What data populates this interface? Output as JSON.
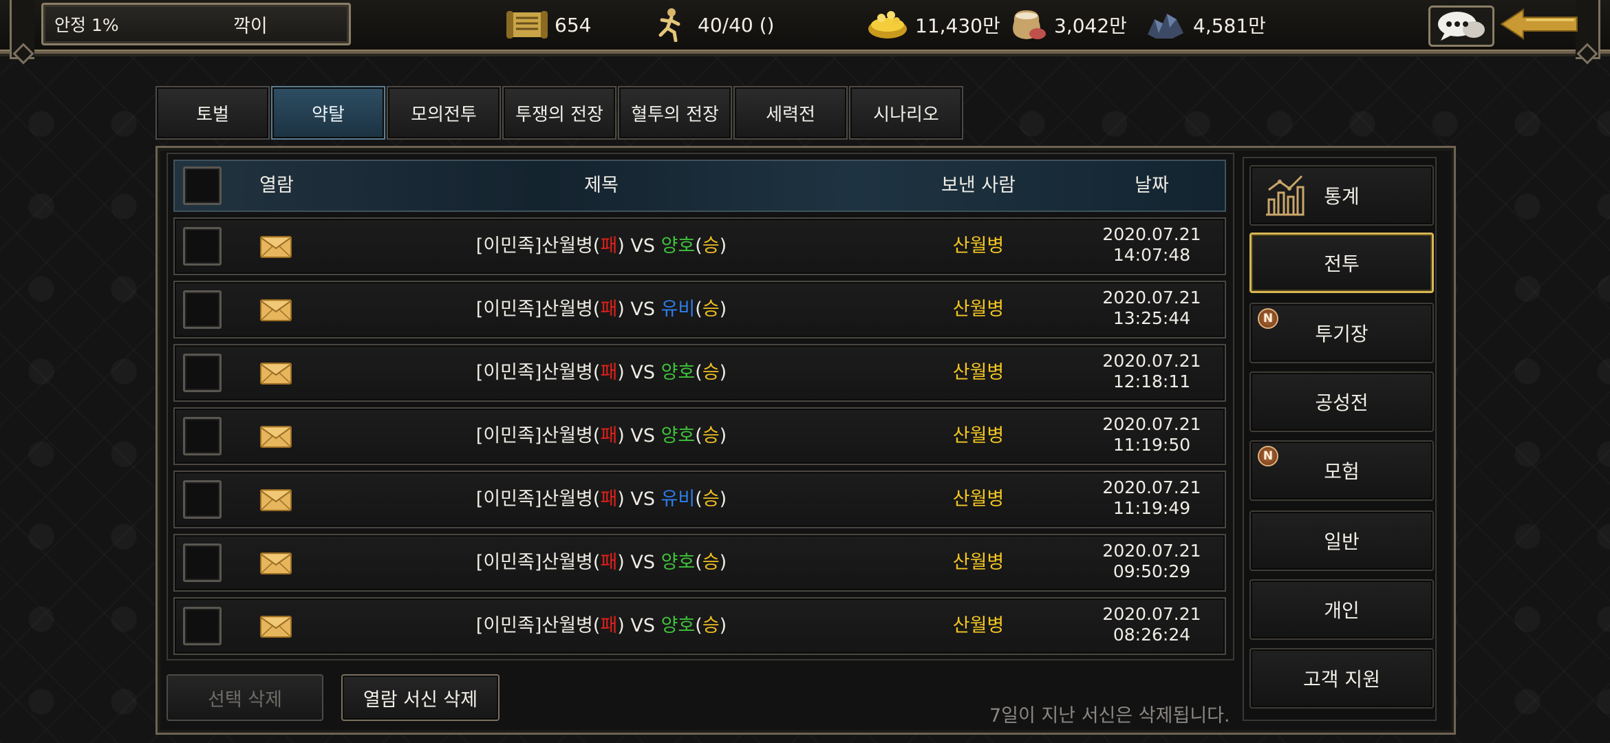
{
  "topbar": {
    "stability": "안정 1%",
    "character_name": "깍이",
    "resources": [
      {
        "icon": "scroll-icon",
        "value": "654"
      },
      {
        "icon": "running-soldier-icon",
        "value": "40/40 ()"
      },
      {
        "icon": "gold-ingot-icon",
        "value": "11,430만"
      },
      {
        "icon": "food-sack-icon",
        "value": "3,042만"
      },
      {
        "icon": "ore-icon",
        "value": "4,581만"
      }
    ]
  },
  "tabs": [
    {
      "label": "토벌",
      "active": false
    },
    {
      "label": "약탈",
      "active": true
    },
    {
      "label": "모의전투",
      "active": false
    },
    {
      "label": "투쟁의 전장",
      "active": false
    },
    {
      "label": "혈투의 전장",
      "active": false
    },
    {
      "label": "세력전",
      "active": false
    },
    {
      "label": "시나리오",
      "active": false
    }
  ],
  "table": {
    "headers": {
      "read": "열람",
      "title": "제목",
      "sender": "보낸 사람",
      "date": "날짜"
    },
    "rows": [
      {
        "prefix": "[이민족]산월병(",
        "loser_mark": "패",
        "vs": ") VS ",
        "opponent": "양호",
        "opp_color": "green",
        "open": "(",
        "win_mark": "승",
        "close": ")",
        "sender": "산월병",
        "date": "2020.07.21",
        "time": "14:07:48"
      },
      {
        "prefix": "[이민족]산월병(",
        "loser_mark": "패",
        "vs": ") VS ",
        "opponent": "유비",
        "opp_color": "blue",
        "open": "(",
        "win_mark": "승",
        "close": ")",
        "sender": "산월병",
        "date": "2020.07.21",
        "time": "13:25:44"
      },
      {
        "prefix": "[이민족]산월병(",
        "loser_mark": "패",
        "vs": ") VS ",
        "opponent": "양호",
        "opp_color": "green",
        "open": "(",
        "win_mark": "승",
        "close": ")",
        "sender": "산월병",
        "date": "2020.07.21",
        "time": "12:18:11"
      },
      {
        "prefix": "[이민족]산월병(",
        "loser_mark": "패",
        "vs": ") VS ",
        "opponent": "양호",
        "opp_color": "green",
        "open": "(",
        "win_mark": "승",
        "close": ")",
        "sender": "산월병",
        "date": "2020.07.21",
        "time": "11:19:50"
      },
      {
        "prefix": "[이민족]산월병(",
        "loser_mark": "패",
        "vs": ") VS ",
        "opponent": "유비",
        "opp_color": "blue",
        "open": "(",
        "win_mark": "승",
        "close": ")",
        "sender": "산월병",
        "date": "2020.07.21",
        "time": "11:19:49"
      },
      {
        "prefix": "[이민족]산월병(",
        "loser_mark": "패",
        "vs": ") VS ",
        "opponent": "양호",
        "opp_color": "green",
        "open": "(",
        "win_mark": "승",
        "close": ")",
        "sender": "산월병",
        "date": "2020.07.21",
        "time": "09:50:29"
      },
      {
        "prefix": "[이민족]산월병(",
        "loser_mark": "패",
        "vs": ") VS ",
        "opponent": "양호",
        "opp_color": "green",
        "open": "(",
        "win_mark": "승",
        "close": ")",
        "sender": "산월병",
        "date": "2020.07.21",
        "time": "08:26:24"
      }
    ]
  },
  "footer": {
    "delete_selected": "선택 삭제",
    "delete_read": "열람 서신 삭제",
    "notice": "7일이 지난 서신은 삭제됩니다."
  },
  "side_menu": [
    {
      "label": "통계",
      "icon": "bar-chart-icon",
      "badge": null,
      "active": false
    },
    {
      "label": "전투",
      "icon": null,
      "badge": null,
      "active": true
    },
    {
      "label": "투기장",
      "icon": null,
      "badge": "N",
      "active": false
    },
    {
      "label": "공성전",
      "icon": null,
      "badge": null,
      "active": false
    },
    {
      "label": "모험",
      "icon": null,
      "badge": "N",
      "active": false
    },
    {
      "label": "일반",
      "icon": null,
      "badge": null,
      "active": false
    },
    {
      "label": "개인",
      "icon": null,
      "badge": null,
      "active": false
    },
    {
      "label": "고객 지원",
      "icon": null,
      "badge": null,
      "active": false
    }
  ],
  "colors": {
    "sender": "#f3c623",
    "loss": "#e0201a",
    "win": "#f1be22",
    "opponent_green": "#3fc23a",
    "opponent_blue": "#2d7de8",
    "active_tab": "#2f4e63",
    "active_side_border": "#d6b756"
  }
}
